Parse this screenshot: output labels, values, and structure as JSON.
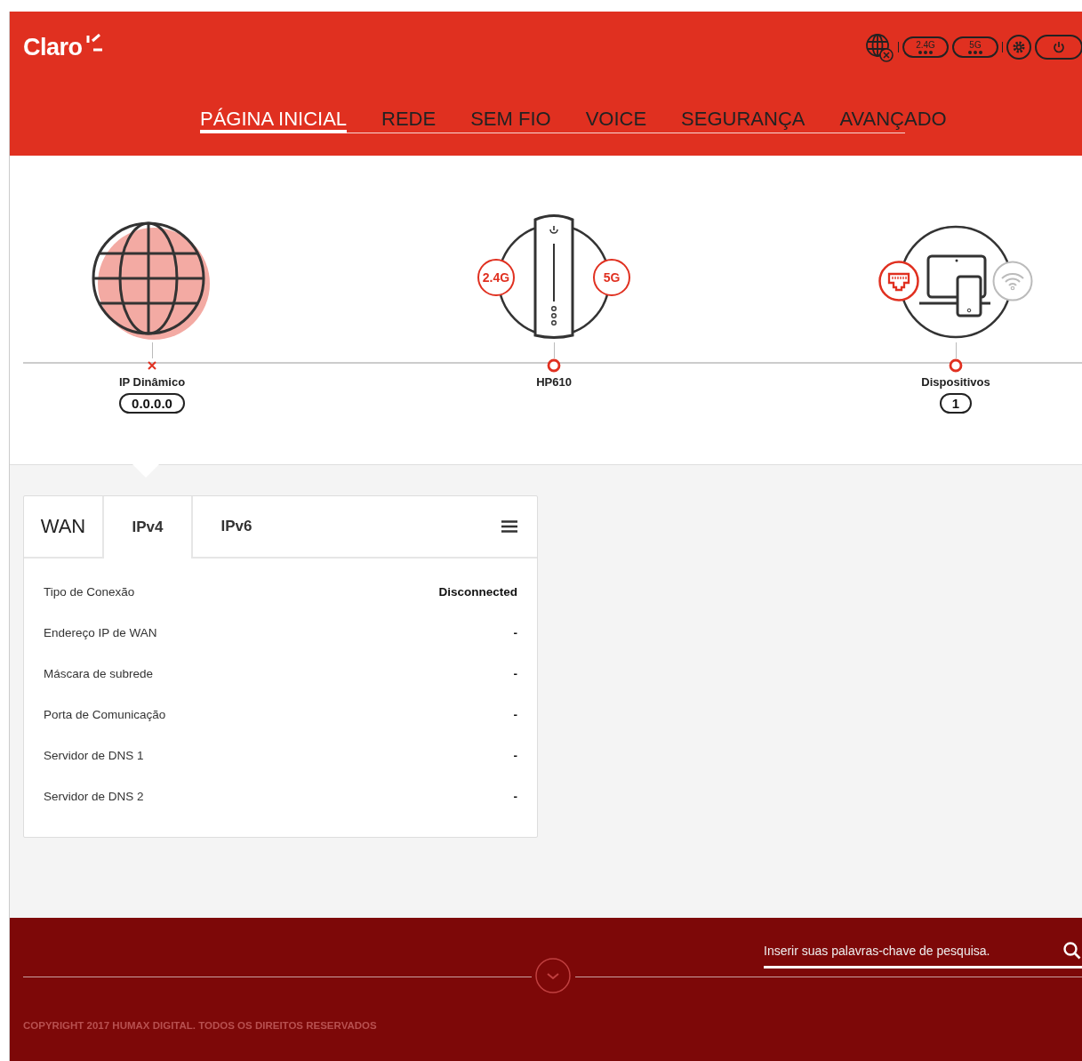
{
  "header": {
    "logo": "Claro",
    "status": {
      "internet_connected": false,
      "bands": [
        {
          "label": "2.4G"
        },
        {
          "label": "5G"
        }
      ]
    }
  },
  "nav": [
    {
      "label": "PÁGINA INICIAL",
      "selected": true
    },
    {
      "label": "REDE",
      "selected": false
    },
    {
      "label": "SEM FIO",
      "selected": false
    },
    {
      "label": "VOICE",
      "selected": false
    },
    {
      "label": "SEGURANÇA",
      "selected": false
    },
    {
      "label": "AVANÇADO",
      "selected": false
    }
  ],
  "topology": [
    {
      "kind": "internet",
      "label": "IP Dinâmico",
      "value": "0.0.0.0",
      "connected": false
    },
    {
      "kind": "router",
      "label": "HP610",
      "badges": [
        "2.4G",
        "5G"
      ],
      "connected": true
    },
    {
      "kind": "devices",
      "label": "Dispositivos",
      "value": "1",
      "connected": true
    }
  ],
  "panel": {
    "title": "WAN",
    "tabs": [
      {
        "label": "IPv4",
        "selected": true
      },
      {
        "label": "IPv6",
        "selected": false
      }
    ],
    "rows": [
      {
        "label": "Tipo de Conexão",
        "value": "Disconnected"
      },
      {
        "label": "Endereço IP de WAN",
        "value": "-"
      },
      {
        "label": "Máscara de subrede",
        "value": "-"
      },
      {
        "label": "Porta de Comunicação",
        "value": "-"
      },
      {
        "label": "Servidor de DNS 1",
        "value": "-"
      },
      {
        "label": "Servidor de DNS 2",
        "value": "-"
      }
    ]
  },
  "footer": {
    "search": {
      "placeholder": "Inserir suas palavras-chave de pesquisa."
    },
    "copyright": "COPYRIGHT 2017 HUMAX DIGITAL. TODOS OS DIREITOS RESERVADOS"
  }
}
